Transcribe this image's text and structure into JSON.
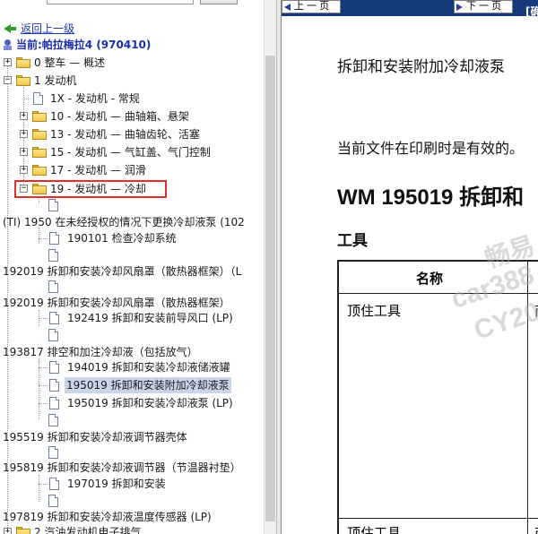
{
  "tree": {
    "back_label": "返回上一级",
    "current_label": "当前:帕拉梅拉4 (970410)",
    "selected_item": "195019 拆卸和安装附加冷却液泵",
    "rows": [
      "0 整车 — 概述",
      "1 发动机",
      "1X - 发动机 - 常规",
      "10 - 发动机 — 曲轴箱、悬架",
      "13 - 发动机 — 曲轴齿轮、活塞",
      "15 - 发动机 — 气缸盖、气门控制",
      "17 - 发动机 — 润滑",
      "19 - 发动机 — 冷却",
      "(TI) 1950 在未经授权的情况下更换冷却液泵 (102",
      "190101 检查冷却系统",
      "192019 拆卸和安装冷却风扇罩（散热器框架）（L",
      "192019 拆卸和安装冷却风扇罩（散热器框架）",
      "192419 拆卸和安装前导风口 (LP)",
      "193817 排空和加注冷却液（包括放气）",
      "194019 拆卸和安装冷却液储液罐",
      "195019 拆卸和安装附加冷却液泵",
      "195019 拆卸和安装冷却液泵 (LP)",
      "195519 拆卸和安装冷却液调节器壳体",
      "195819 拆卸和安装冷却液调节器（节温器衬垫）",
      "197019 拆卸和安装",
      "197819 拆卸和安装冷却液温度传感器 (LP)",
      "2 汽油发动机电子排气"
    ]
  },
  "doc": {
    "prev_label": "上 一 页",
    "next_label": "下 一 页",
    "nav_tag": "[确",
    "line1": "拆卸和安装附加冷却液泵",
    "line2": "当前文件在印刷时是有效的。",
    "title": "WM 195019 拆卸和",
    "tools_heading": "工具",
    "table": {
      "col_name": "名称",
      "row1": "顶住工具",
      "row1_col2": "商",
      "row2": "顶住工具",
      "row2_col2": "商"
    },
    "watermark": [
      "畅易",
      "car388",
      "CY20"
    ]
  },
  "colors": {
    "header_bar": "#143a7a",
    "highlight_box": "#e03030",
    "selected_bg": "#c9d6ea",
    "link": "#1a3aa8"
  }
}
